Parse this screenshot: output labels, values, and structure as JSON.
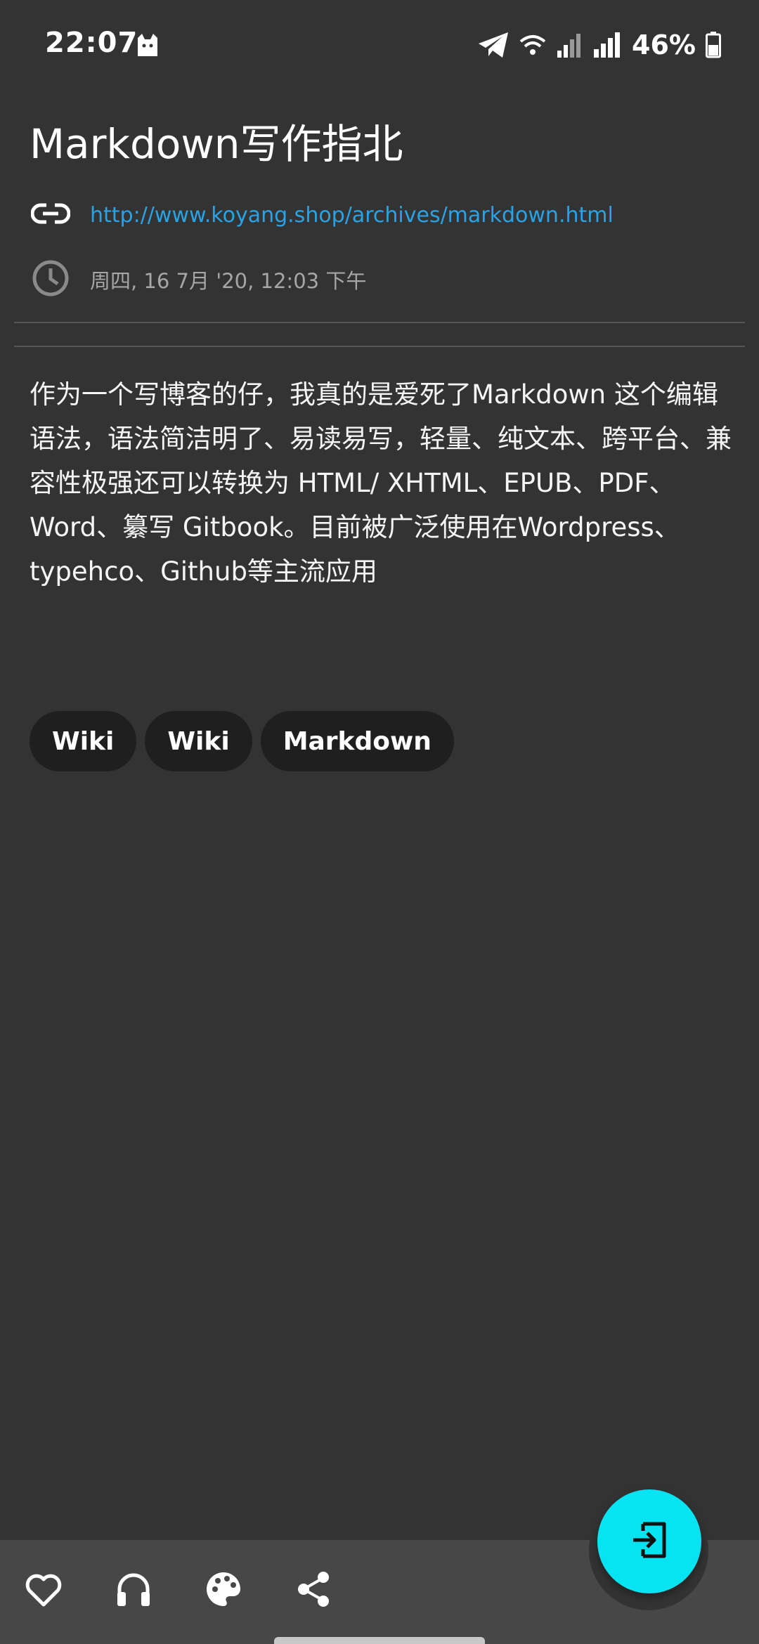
{
  "status_bar": {
    "time": "22:07",
    "battery_percent": "46%",
    "icons": [
      "cat-icon",
      "telegram-icon",
      "wifi-icon",
      "signal-icon",
      "signal-icon",
      "battery-icon"
    ]
  },
  "article": {
    "title": "Markdown写作指北",
    "url": "http://www.koyang.shop/archives/markdown.html",
    "date": "周四, 16 7月 '20, 12:03 下午",
    "body": "作为一个写博客的仔，我真的是爱死了Markdown 这个编辑语法，语法简洁明了、易读易写，轻量、纯文本、跨平台、兼容性极强还可以转换为 HTML/ XHTML、EPUB、PDF、Word、纂写 Gitbook。目前被广泛使用在Wordpress、typehco、Github等主流应用",
    "tags": [
      "Wiki",
      "Wiki",
      "Markdown"
    ]
  },
  "bottom_bar": {
    "actions": [
      "heart-icon",
      "headphones-icon",
      "palette-icon",
      "share-icon"
    ],
    "fab_icon": "exit-icon"
  },
  "colors": {
    "background": "#333333",
    "link": "#2aa3e6",
    "fab": "#08e3f2",
    "bottom_bar": "#474747",
    "tag_bg": "#1f1f1f"
  }
}
